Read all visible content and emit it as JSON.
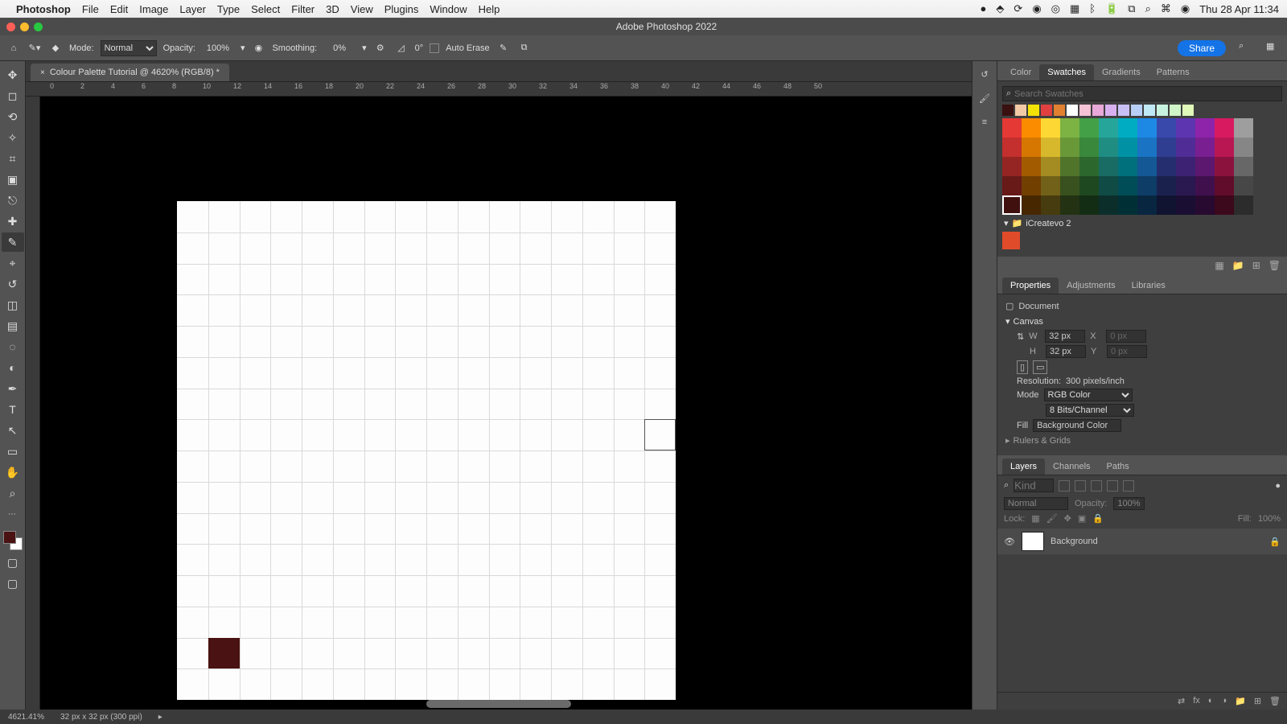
{
  "menubar": {
    "app": "Photoshop",
    "items": [
      "File",
      "Edit",
      "Image",
      "Layer",
      "Type",
      "Select",
      "Filter",
      "3D",
      "View",
      "Plugins",
      "Window",
      "Help"
    ],
    "clock": "Thu 28 Apr  11:34",
    "status_icons": [
      "record-icon",
      "dropbox-icon",
      "cloud-sync-icon",
      "cc-icon",
      "eye-icon",
      "grid-icon",
      "bluetooth-icon",
      "battery-icon",
      "wifi-icon",
      "search-icon",
      "control-center-icon",
      "siri-icon"
    ]
  },
  "window": {
    "title": "Adobe Photoshop 2022"
  },
  "optionsbar": {
    "mode_label": "Mode:",
    "mode_value": "Normal",
    "opacity_label": "Opacity:",
    "opacity_value": "100%",
    "smoothing_label": "Smoothing:",
    "smoothing_value": "0%",
    "angle_value": "0°",
    "auto_erase_label": "Auto Erase",
    "share_label": "Share"
  },
  "document": {
    "tab_title": "Colour Palette Tutorial @ 4620% (RGB/8) *",
    "ruler_ticks": [
      "0",
      "2",
      "4",
      "6",
      "8",
      "10",
      "12",
      "14",
      "16",
      "18",
      "20",
      "22",
      "24",
      "26",
      "28",
      "30",
      "32",
      "34",
      "36",
      "38",
      "40",
      "42",
      "44",
      "46",
      "48",
      "50"
    ],
    "foreground_color": "#4a1212",
    "background_color": "#ffffff",
    "painted_pixel": {
      "col": 1,
      "row": 14
    },
    "cursor_cell": {
      "col": 15,
      "row": 7
    }
  },
  "statusbar": {
    "zoom": "4621.41%",
    "docinfo": "32 px x 32 px (300 ppi)"
  },
  "swatches_panel": {
    "tabs": [
      "Color",
      "Swatches",
      "Gradients",
      "Patterns"
    ],
    "active_tab": "Swatches",
    "search_placeholder": "Search Swatches",
    "recent": [
      "#3a1010",
      "#f2c9a5",
      "#f2e205",
      "#e04040",
      "#e08030",
      "#ffffff",
      "#f5c2d5",
      "#e8a8d8",
      "#d8b0f0",
      "#c8c0f5",
      "#b8d0f8",
      "#c0e8f5",
      "#c8f2e0",
      "#d0f5c8",
      "#e0f8b8"
    ],
    "grid": {
      "hues": [
        "#e53935",
        "#fb8c00",
        "#fdd835",
        "#7cb342",
        "#43a047",
        "#26a69a",
        "#00acc1",
        "#1e88e5",
        "#3949ab",
        "#5e35b1",
        "#8e24aa",
        "#d81b60",
        "#9e9e9e"
      ],
      "shades": [
        1.0,
        0.85,
        0.65,
        0.45,
        0.28
      ]
    },
    "selected": {
      "row": 4,
      "col": 0
    },
    "folder": "iCreatevo 2",
    "folder_swatch": "#e04b2a"
  },
  "properties_panel": {
    "tabs": [
      "Properties",
      "Adjustments",
      "Libraries"
    ],
    "active_tab": "Properties",
    "type_label": "Document",
    "canvas_label": "Canvas",
    "W_label": "W",
    "W_value": "32 px",
    "H_label": "H",
    "H_value": "32 px",
    "X_label": "X",
    "X_value": "0 px",
    "Y_label": "Y",
    "Y_value": "0 px",
    "resolution_label": "Resolution:",
    "resolution_value": "300 pixels/inch",
    "mode_label": "Mode",
    "mode_value": "RGB Color",
    "depth_value": "8 Bits/Channel",
    "fill_label": "Fill",
    "fill_value": "Background Color",
    "next_section": "Rulers & Grids"
  },
  "layers_panel": {
    "tabs": [
      "Layers",
      "Channels",
      "Paths"
    ],
    "active_tab": "Layers",
    "kind_placeholder": "Kind",
    "blend_mode": "Normal",
    "opacity_label": "Opacity:",
    "opacity_value": "100%",
    "lock_label": "Lock:",
    "fill_label": "Fill:",
    "fill_value": "100%",
    "layer_name": "Background"
  },
  "tools": [
    "move",
    "marquee",
    "lasso",
    "wand",
    "crop",
    "frame",
    "eyedropper",
    "heal",
    "brush",
    "clone",
    "history-brush",
    "eraser",
    "gradient",
    "blur",
    "dodge",
    "pen",
    "type",
    "path-select",
    "rectangle",
    "hand",
    "zoom"
  ],
  "selected_tool_index": 8
}
